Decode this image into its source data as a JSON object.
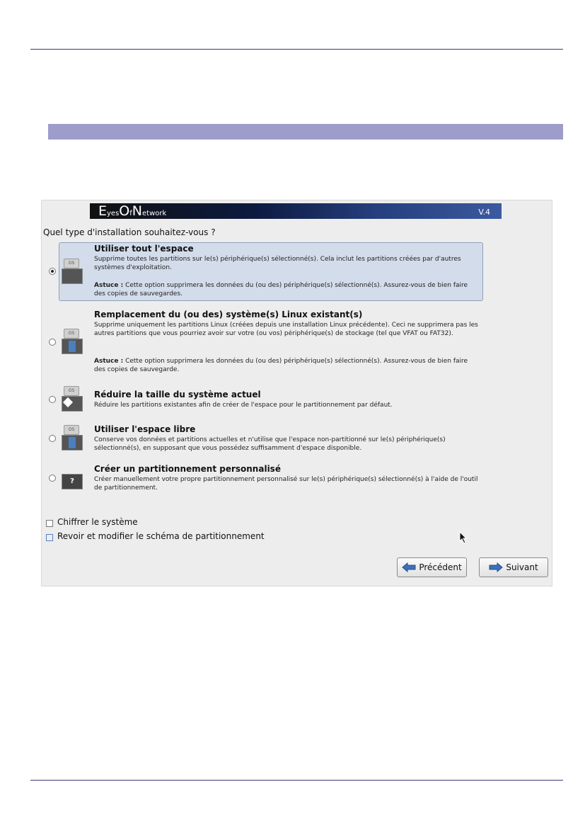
{
  "installer": {
    "logo_text": "EyesOfNetwork",
    "logo_parts": {
      "e": "E",
      "yes": "yes",
      "o": "O",
      "f": "f",
      "n": "N",
      "etwork": "etwork"
    },
    "version": "V.4",
    "question": "Quel type d'installation souhaitez-vous ?",
    "options": [
      {
        "title": "Utiliser tout l'espace",
        "desc": "Supprime toutes les partitions sur le(s) périphérique(s) sélectionné(s). Cela inclut les partitions créées par d'autres systèmes d'exploitation.",
        "tip_label": "Astuce :",
        "tip": "Cette option supprimera les données du (ou des) périphérique(s) sélectionné(s). Assurez-vous de bien faire des copies de sauvegardes.",
        "selected": true
      },
      {
        "title": "Remplacement du (ou des) système(s) Linux existant(s)",
        "desc": "Supprime uniquement les partitions Linux (créées depuis une installation Linux précédente). Ceci ne supprimera pas les autres partitions que vous pourriez avoir sur votre (ou vos) périphérique(s) de stockage (tel que VFAT ou FAT32).",
        "tip_label": "Astuce :",
        "tip": "Cette option supprimera les données du (ou des) périphérique(s) sélectionné(s). Assurez-vous de bien faire des copies de sauvegarde.",
        "selected": false
      },
      {
        "title": "Réduire la taille du système actuel",
        "desc": "Réduire les partitions existantes afin de créer de l'espace pour le partitionnement par défaut.",
        "selected": false
      },
      {
        "title": "Utiliser l'espace libre",
        "desc": "Conserve vos données et partitions actuelles et n'utilise que l'espace non-partitionné sur le(s) périphérique(s) sélectionné(s), en supposant que vous possédez suffisamment d'espace disponible.",
        "selected": false
      },
      {
        "title": "Créer un partitionnement personnalisé",
        "desc": "Créer manuellement votre propre partitionnement personnalisé sur le(s) périphérique(s) sélectionné(s) à l'aide de l'outil de partitionnement.",
        "selected": false
      }
    ],
    "icon_os_label": "OS",
    "icon_custom_label": "?",
    "checkboxes": [
      {
        "label": "Chiffrer le système",
        "checked": false
      },
      {
        "label": "Revoir et modifier le schéma de partitionnement",
        "checked": false
      }
    ],
    "buttons": {
      "back": "Précédent",
      "next": "Suivant"
    }
  },
  "colors": {
    "rule": "#3a3a70",
    "section_bar": "#9e9ccb",
    "selected_option": "#d3dcea",
    "arrow_blue": "#3f6fb8"
  }
}
